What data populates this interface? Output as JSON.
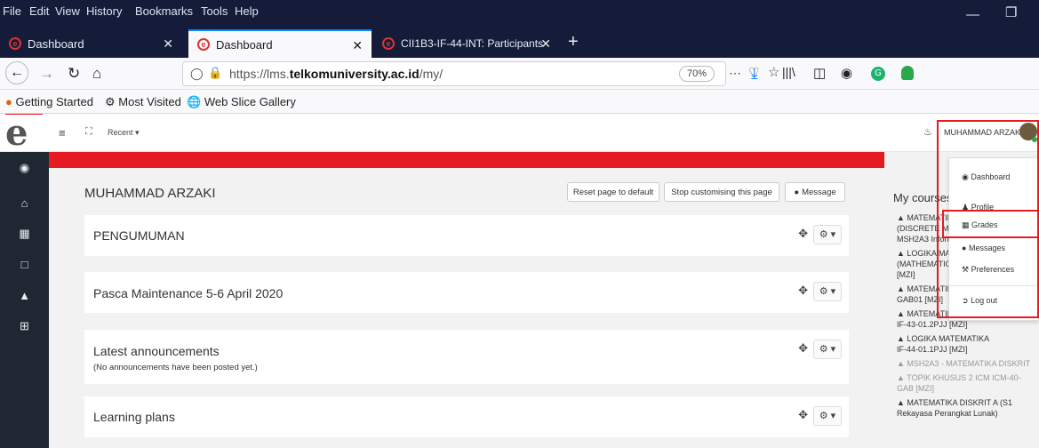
{
  "menubar": {
    "items": [
      "File",
      "Edit",
      "View",
      "History",
      "Bookmarks",
      "Tools",
      "Help"
    ]
  },
  "tabs": [
    {
      "label": "Dashboard"
    },
    {
      "label": "Dashboard"
    },
    {
      "label": "CII1B3-IF-44-INT: Participants"
    }
  ],
  "nav": {
    "url_prefix": "https://lms.",
    "url_host": "telkomuniversity.ac.id",
    "url_path": "/my/",
    "zoom": "70%"
  },
  "bookmarks": [
    "Getting Started",
    "Most Visited",
    "Web Slice Gallery"
  ],
  "lms": {
    "recent": "Recent ▾",
    "user_name": "MUHAMMAD ARZAKI",
    "page_title": "MUHAMMAD ARZAKI",
    "reset_btn": "Reset page to default",
    "stop_btn": "Stop customising this page",
    "message_btn": "Message",
    "cards": [
      {
        "title": "PENGUMUMAN",
        "body": ""
      },
      {
        "title": "Pasca Maintenance 5-6 April 2020",
        "body": ""
      },
      {
        "title": "Latest announcements",
        "body": "(No announcements have been posted yet.)"
      },
      {
        "title": "Learning plans",
        "body": ""
      }
    ],
    "mycourses": "My courses",
    "courses": [
      {
        "lines": [
          "MATEMATIKA",
          "(DISCRETE MATI",
          "MSH2A3 Inform"
        ],
        "faded": false
      },
      {
        "lines": [
          "LOGIKA MATI",
          "(MATHEMATICA",
          "[MZI]"
        ],
        "faded": false
      },
      {
        "lines": [
          "MATEMATIKA",
          "GAB01 [MZI]"
        ],
        "faded": false
      },
      {
        "lines": [
          "MATEMATIKA DISKRIT",
          "IF-43-01.2PJJ [MZI]"
        ],
        "faded": false
      },
      {
        "lines": [
          "LOGIKA MATEMATIKA",
          "IF-44-01.1PJJ [MZI]"
        ],
        "faded": false
      },
      {
        "lines": [
          "MSH2A3 - MATEMATIKA DISKRIT"
        ],
        "faded": true
      },
      {
        "lines": [
          "TOPIK KHUSUS 2 ICM ICM-40-",
          "GAB [MZI]"
        ],
        "faded": true
      },
      {
        "lines": [
          "MATEMATIKA DISKRIT A (S1",
          "Rekayasa Perangkat Lunak)"
        ],
        "faded": false
      }
    ],
    "usermenu": [
      "Dashboard",
      "Profile",
      "Grades",
      "Messages",
      "Preferences",
      "Log out"
    ]
  },
  "colors": {
    "accent": "#e61b22",
    "drawer": "#1f2732",
    "titlebar": "#141c39"
  }
}
